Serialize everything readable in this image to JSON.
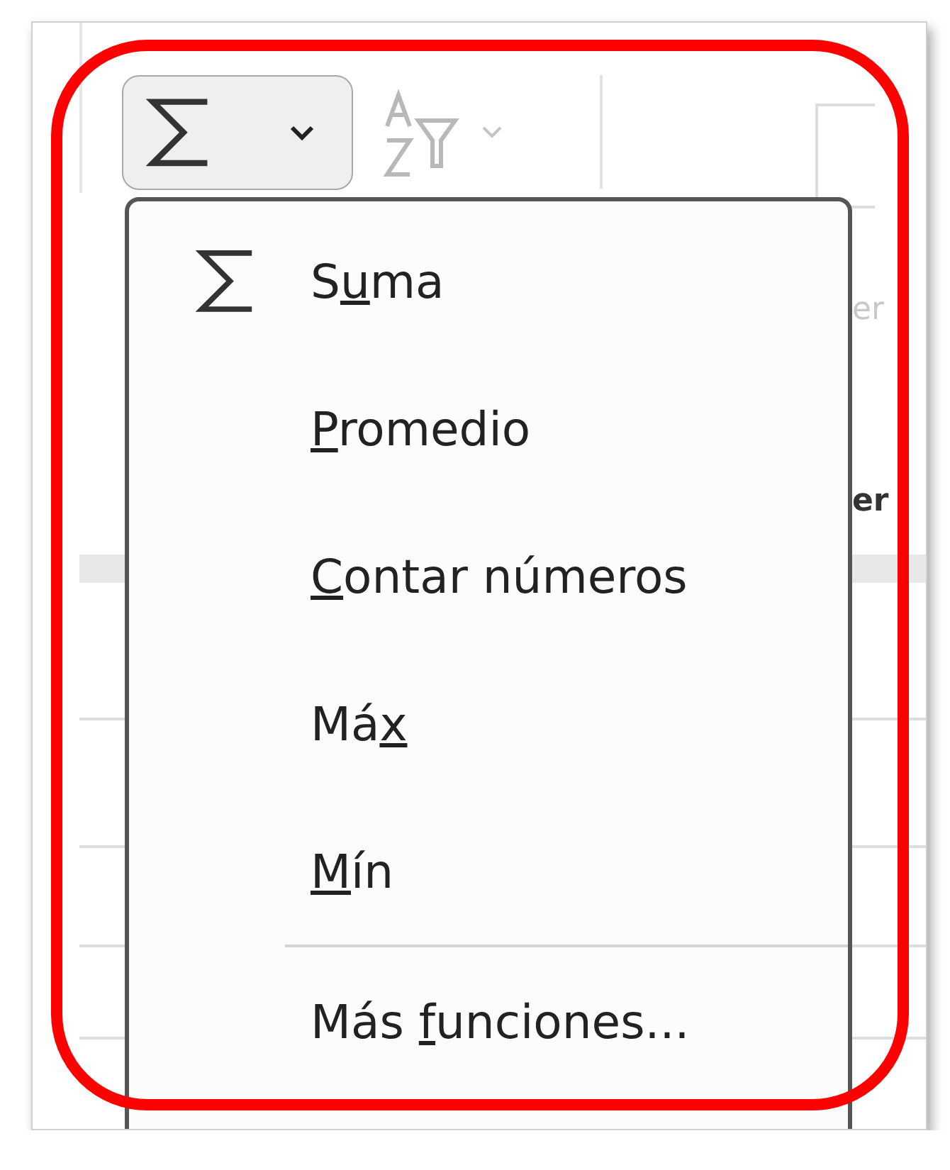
{
  "ribbon": {
    "autosum_button": {
      "expanded": true
    },
    "fragments": [
      {
        "text": "er",
        "kind": "faint"
      },
      {
        "text": "er",
        "kind": "bold"
      }
    ]
  },
  "menu": {
    "items": [
      {
        "label_start": "S",
        "access_key": "u",
        "label_end": "ma",
        "kind": "sigma"
      },
      {
        "access_key": "P",
        "label_end": "romedio",
        "kind": "plain"
      },
      {
        "access_key": "C",
        "label_end": "ontar números",
        "kind": "plain"
      },
      {
        "label_start": "Má",
        "access_key": "x",
        "kind": "plain"
      },
      {
        "access_key": "M",
        "label_end": "ín",
        "kind": "plain",
        "separator_after": true
      },
      {
        "label_start": "Más ",
        "access_key": "f",
        "label_end": "unciones...",
        "kind": "plain"
      }
    ]
  }
}
